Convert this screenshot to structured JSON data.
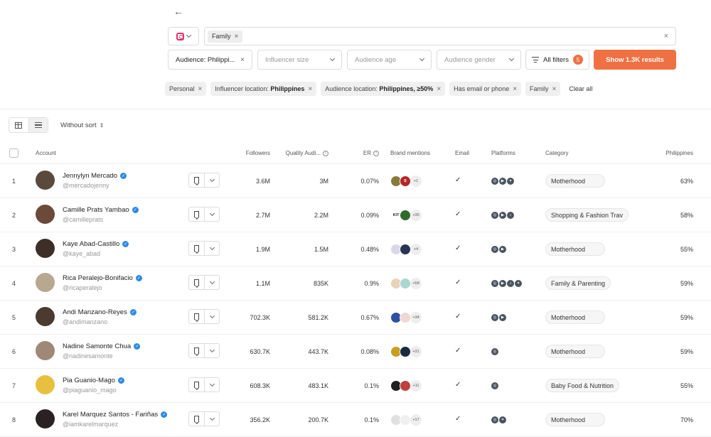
{
  "header": {
    "back_icon": "arrow-left-icon",
    "platform_icon": "instagram-icon",
    "search": {
      "keyword": "Family"
    }
  },
  "filters": {
    "audience": "Audience: Philippi...",
    "influencer_size": "Influencer size",
    "audience_age": "Audience age",
    "audience_gender": "Audience gender",
    "all_filters": "All filters",
    "all_filters_count": "5",
    "show_results": "Show 1.3K results"
  },
  "chips": [
    {
      "text": "Personal",
      "bold": ""
    },
    {
      "text": "Influencer location: ",
      "bold": "Philippines"
    },
    {
      "text": "Audience location: ",
      "bold": "Philippines, ≥50%"
    },
    {
      "text": "Has email or phone",
      "bold": ""
    },
    {
      "text": "Family",
      "bold": ""
    }
  ],
  "clear_all": "Clear all",
  "sort_label": "Without sort",
  "columns": {
    "account": "Account",
    "followers": "Followers",
    "quality": "Quality Audi...",
    "er": "ER",
    "brand_mentions": "Brand mentions",
    "email": "Email",
    "platforms": "Platforms",
    "category": "Category",
    "country": "Philippines"
  },
  "rows": [
    {
      "rank": "1",
      "name": "Jennylyn Mercado",
      "handle": "@mercadojenny",
      "followers": "3.6M",
      "quality": "3M",
      "er": "0.07%",
      "mentions": [
        {
          "c": "#8a7a3a",
          "t": ""
        },
        {
          "c": "#b3262a",
          "t": "S"
        }
      ],
      "more": "+1",
      "email": "✓",
      "platforms": [
        "IG",
        "YT",
        "TW"
      ],
      "category": "Motherhood",
      "pct": "63%",
      "avatar": "#5a4a3e"
    },
    {
      "rank": "2",
      "name": "Camille Prats Yambao",
      "handle": "@camilleprats",
      "followers": "2.7M",
      "quality": "2.2M",
      "er": "0.09%",
      "mentions": [
        {
          "c": "#ffffff",
          "t": "KIT"
        },
        {
          "c": "#2f6b2f",
          "t": ""
        }
      ],
      "more": "+35",
      "email": "✓",
      "platforms": [
        "IG",
        "YT",
        "TT"
      ],
      "category": "Shopping & Fashion Trav",
      "pct": "58%",
      "avatar": "#6b4a3a"
    },
    {
      "rank": "3",
      "name": "Kaye Abad-Castillo",
      "handle": "@kaye_abad",
      "followers": "1.9M",
      "quality": "1.5M",
      "er": "0.48%",
      "mentions": [
        {
          "c": "#d8d8e8",
          "t": ""
        },
        {
          "c": "#2a3552",
          "t": ""
        }
      ],
      "more": "+4",
      "email": "✓",
      "platforms": [
        "IG",
        "YT"
      ],
      "category": "Motherhood",
      "pct": "55%",
      "avatar": "#3e2e28"
    },
    {
      "rank": "4",
      "name": "Rica Peralejo-Bonifacio",
      "handle": "@ricaperalejo",
      "followers": "1.1M",
      "quality": "835K",
      "er": "0.9%",
      "mentions": [
        {
          "c": "#e8d2b8",
          "t": ""
        },
        {
          "c": "#a8d8d0",
          "t": ""
        }
      ],
      "more": "+58",
      "email": "✓",
      "platforms": [
        "IG",
        "YT",
        "TT",
        "TW"
      ],
      "category": "Family & Parenting",
      "pct": "59%",
      "avatar": "#b8a890"
    },
    {
      "rank": "5",
      "name": "Andi Manzano-Reyes",
      "handle": "@andimanzano",
      "followers": "702.3K",
      "quality": "581.2K",
      "er": "0.67%",
      "mentions": [
        {
          "c": "#3050a0",
          "t": ""
        },
        {
          "c": "#f0d8d0",
          "t": ""
        }
      ],
      "more": "+34",
      "email": "✓",
      "platforms": [
        "IG",
        "YT"
      ],
      "category": "Motherhood",
      "pct": "59%",
      "avatar": "#4a3a30"
    },
    {
      "rank": "6",
      "name": "Nadine Samonte Chua",
      "handle": "@nadinesamonte",
      "followers": "630.7K",
      "quality": "443.7K",
      "er": "0.08%",
      "mentions": [
        {
          "c": "#c8a020",
          "t": ""
        },
        {
          "c": "#1a2a40",
          "t": ""
        }
      ],
      "more": "+31",
      "email": "✓",
      "platforms": [
        "IG"
      ],
      "category": "Motherhood",
      "pct": "59%",
      "avatar": "#a08878"
    },
    {
      "rank": "7",
      "name": "Pia Guanio-Mago",
      "handle": "@piaguanio_mago",
      "followers": "608.3K",
      "quality": "483.1K",
      "er": "0.1%",
      "mentions": [
        {
          "c": "#202020",
          "t": ""
        },
        {
          "c": "#c04040",
          "t": ""
        }
      ],
      "more": "+11",
      "email": "✓",
      "platforms": [
        "IG"
      ],
      "category": "Baby Food & Nutrition",
      "pct": "55%",
      "avatar": "#e8c040"
    },
    {
      "rank": "8",
      "name": "Karel Marquez Santos - Fariñas",
      "handle": "@iamkarelmarquez",
      "followers": "356.2K",
      "quality": "200.7K",
      "er": "0.1%",
      "mentions": [
        {
          "c": "#e0e0e0",
          "t": ""
        },
        {
          "c": "#f0f0f0",
          "t": ""
        }
      ],
      "more": "+17",
      "email": "✓",
      "platforms": [
        "IG",
        "TW"
      ],
      "category": "Motherhood",
      "pct": "70%",
      "avatar": "#2a2222"
    }
  ]
}
